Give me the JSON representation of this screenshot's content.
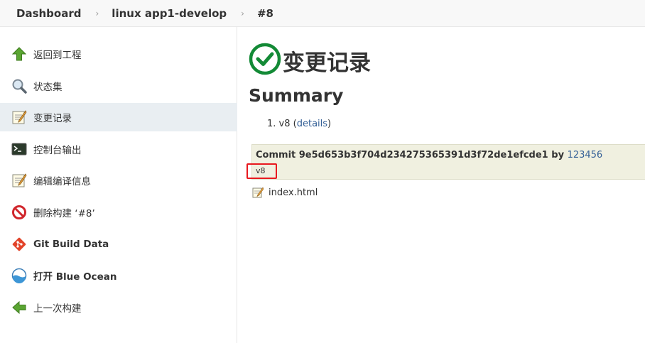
{
  "breadcrumb": {
    "items": [
      "Dashboard",
      "linux app1-develop",
      "#8"
    ],
    "separator": "›"
  },
  "sidebar": {
    "items": [
      {
        "label": "返回到工程",
        "icon": "up-arrow-icon",
        "active": false
      },
      {
        "label": "状态集",
        "icon": "magnifier-icon",
        "active": false
      },
      {
        "label": "变更记录",
        "icon": "notepad-icon",
        "active": true
      },
      {
        "label": "控制台输出",
        "icon": "terminal-icon",
        "active": false
      },
      {
        "label": "编辑编译信息",
        "icon": "notepad-edit-icon",
        "active": false
      },
      {
        "label": "删除构建 ‘#8’",
        "icon": "no-entry-icon",
        "active": false
      },
      {
        "label": "Git Build Data",
        "icon": "git-icon",
        "active": false
      },
      {
        "label": "打开 Blue Ocean",
        "icon": "blue-ocean-icon",
        "active": false
      },
      {
        "label": "上一次构建",
        "icon": "left-arrow-icon",
        "active": false
      }
    ]
  },
  "main": {
    "title": "变更记录",
    "title_icon": "success-check-icon",
    "summary_heading": "Summary",
    "summary_items": [
      {
        "number": "1.",
        "text": "v8",
        "link_open": "(",
        "link": "details",
        "link_close": ")"
      }
    ],
    "commit": {
      "prefix": "Commit",
      "hash": "9e5d653b3f704d234275365391d3f72de1efcde1",
      "by": "by",
      "author": "123456",
      "message": "v8"
    },
    "files": [
      {
        "name": "index.html",
        "icon": "edit-file-icon"
      }
    ]
  },
  "colors": {
    "success": "#138a36",
    "link": "#335f96",
    "commit_bg": "#f0f0e0",
    "highlight": "#e8191f",
    "active_item_bg": "#e9eef2"
  }
}
